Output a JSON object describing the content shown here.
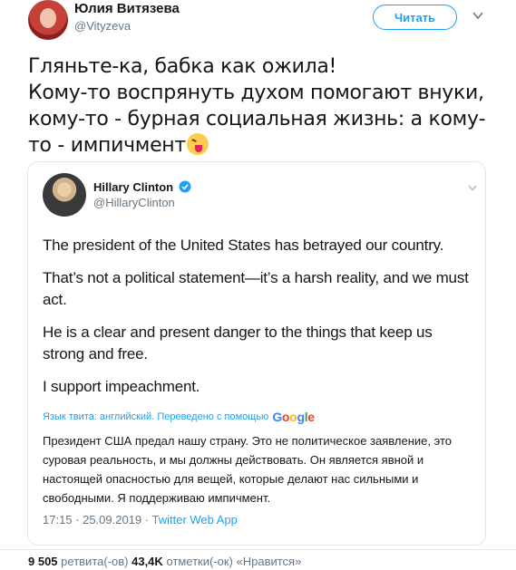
{
  "tweet": {
    "author_name": "Юлия Витязева",
    "author_handle": "@Vityzeva",
    "follow_label": "Читать",
    "text": "Гляньте-ка, бабка как ожила!\nКому-то воспрянуть духом помогают внуки, кому-то - бурная социальная жизнь: а кому-то - импичмент",
    "emoji_icon": "squinting-face-with-tongue-icon"
  },
  "quoted_tweet": {
    "author_name": "Hillary Clinton",
    "author_handle": "@HillaryClinton",
    "paragraphs": [
      "The president of the United States has betrayed our country.",
      "That’s not a political statement—it’s a harsh reality, and we must act.",
      "He is a clear and present danger to the things that keep us strong and free.",
      "I support impeachment."
    ],
    "translate_label": "Язык твита: английский. Переведено с помощью",
    "google_letters": [
      "G",
      "o",
      "o",
      "g",
      "l",
      "e"
    ],
    "translation": "Президент США предал нашу страну. Это не политическое заявление, это суровая реальность, и мы должны действовать. Он является явной и настоящей опасностью для вещей, которые делают нас сильными и свободными. Я поддерживаю импичмент.",
    "timestamp": "17:15 · 25.09.2019 ·",
    "source": "Twitter Web App",
    "retweets": "9 505",
    "retweets_label": "ретвита(-ов)",
    "likes": "43,4K",
    "likes_label": "отметки(-ок) «Нравится»"
  },
  "colors": {
    "accent": "#1da1f2",
    "secondary_text": "#657786",
    "border": "#e1e8ed"
  }
}
